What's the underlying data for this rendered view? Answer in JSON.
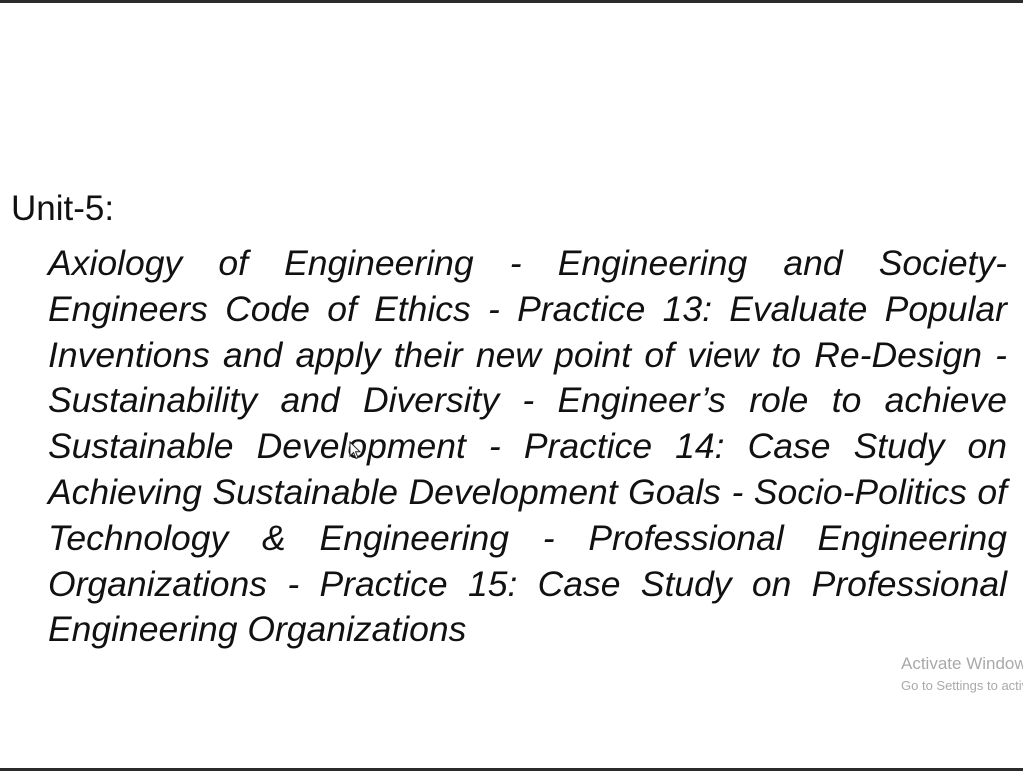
{
  "slide": {
    "heading": "Unit-5:",
    "body": "Axiology of Engineering - Engineering and Society- Engineers Code of Ethics - Practice 13: Evaluate Popular Inventions and apply their new point of view to Re-Design - Sustainability and Diversity - Engineer’s role to achieve Sustainable Development - Practice 14: Case Study on Achieving Sustainable Development Goals - Socio-Politics of Technology & Engineering - Professional Engineering Organizations - Practice 15: Case Study on Professional Engineering Organizations"
  },
  "watermark": {
    "title": "Activate Windows",
    "subtitle": "Go to Settings to activate Windows."
  },
  "icons": {
    "cursor": "mouse-pointer-icon"
  }
}
